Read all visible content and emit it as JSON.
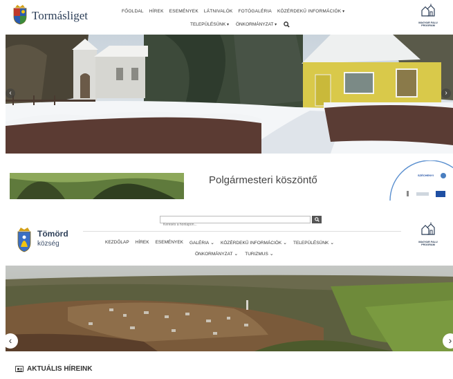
{
  "site1": {
    "title": "Tormásliget",
    "nav_row1": [
      "FŐOLDAL",
      "HÍREK",
      "ESEMÉNYEK",
      "LÁTNIVALÓK",
      "FOTÓGALÉRIA",
      "KÖZÉRDEKŰ INFORMÁCIÓK"
    ],
    "nav_row2": [
      "TELEPÜLÉSÜNK",
      "ÖNKORMÁNYZAT"
    ],
    "search_icon": "search-icon",
    "magyar_falu_label": "MAGYAR FALU PROGRAM",
    "welcome_heading": "Polgármesteri köszöntő",
    "szechenyi_label": "SZÉCHENYI",
    "colors": {
      "brand": "#2c3e57",
      "accent": "#d4a017"
    }
  },
  "site2": {
    "title": "Tömörd",
    "subtitle": "község",
    "search_placeholder": "Keresés a honlapon...",
    "nav_row1": [
      "KEZDŐLAP",
      "HÍREK",
      "ESEMÉNYEK",
      "GALÉRIA",
      "KÖZÉRDEKŰ INFORMÁCIÓK",
      "TELEPÜLÉSÜNK"
    ],
    "nav_row2": [
      "ÖNKORMÁNYZAT",
      "TURIZMUS"
    ],
    "magyar_falu_label": "MAGYAR FALU PROGRAM",
    "news_heading": "AKTUÁLIS HÍREINK"
  }
}
